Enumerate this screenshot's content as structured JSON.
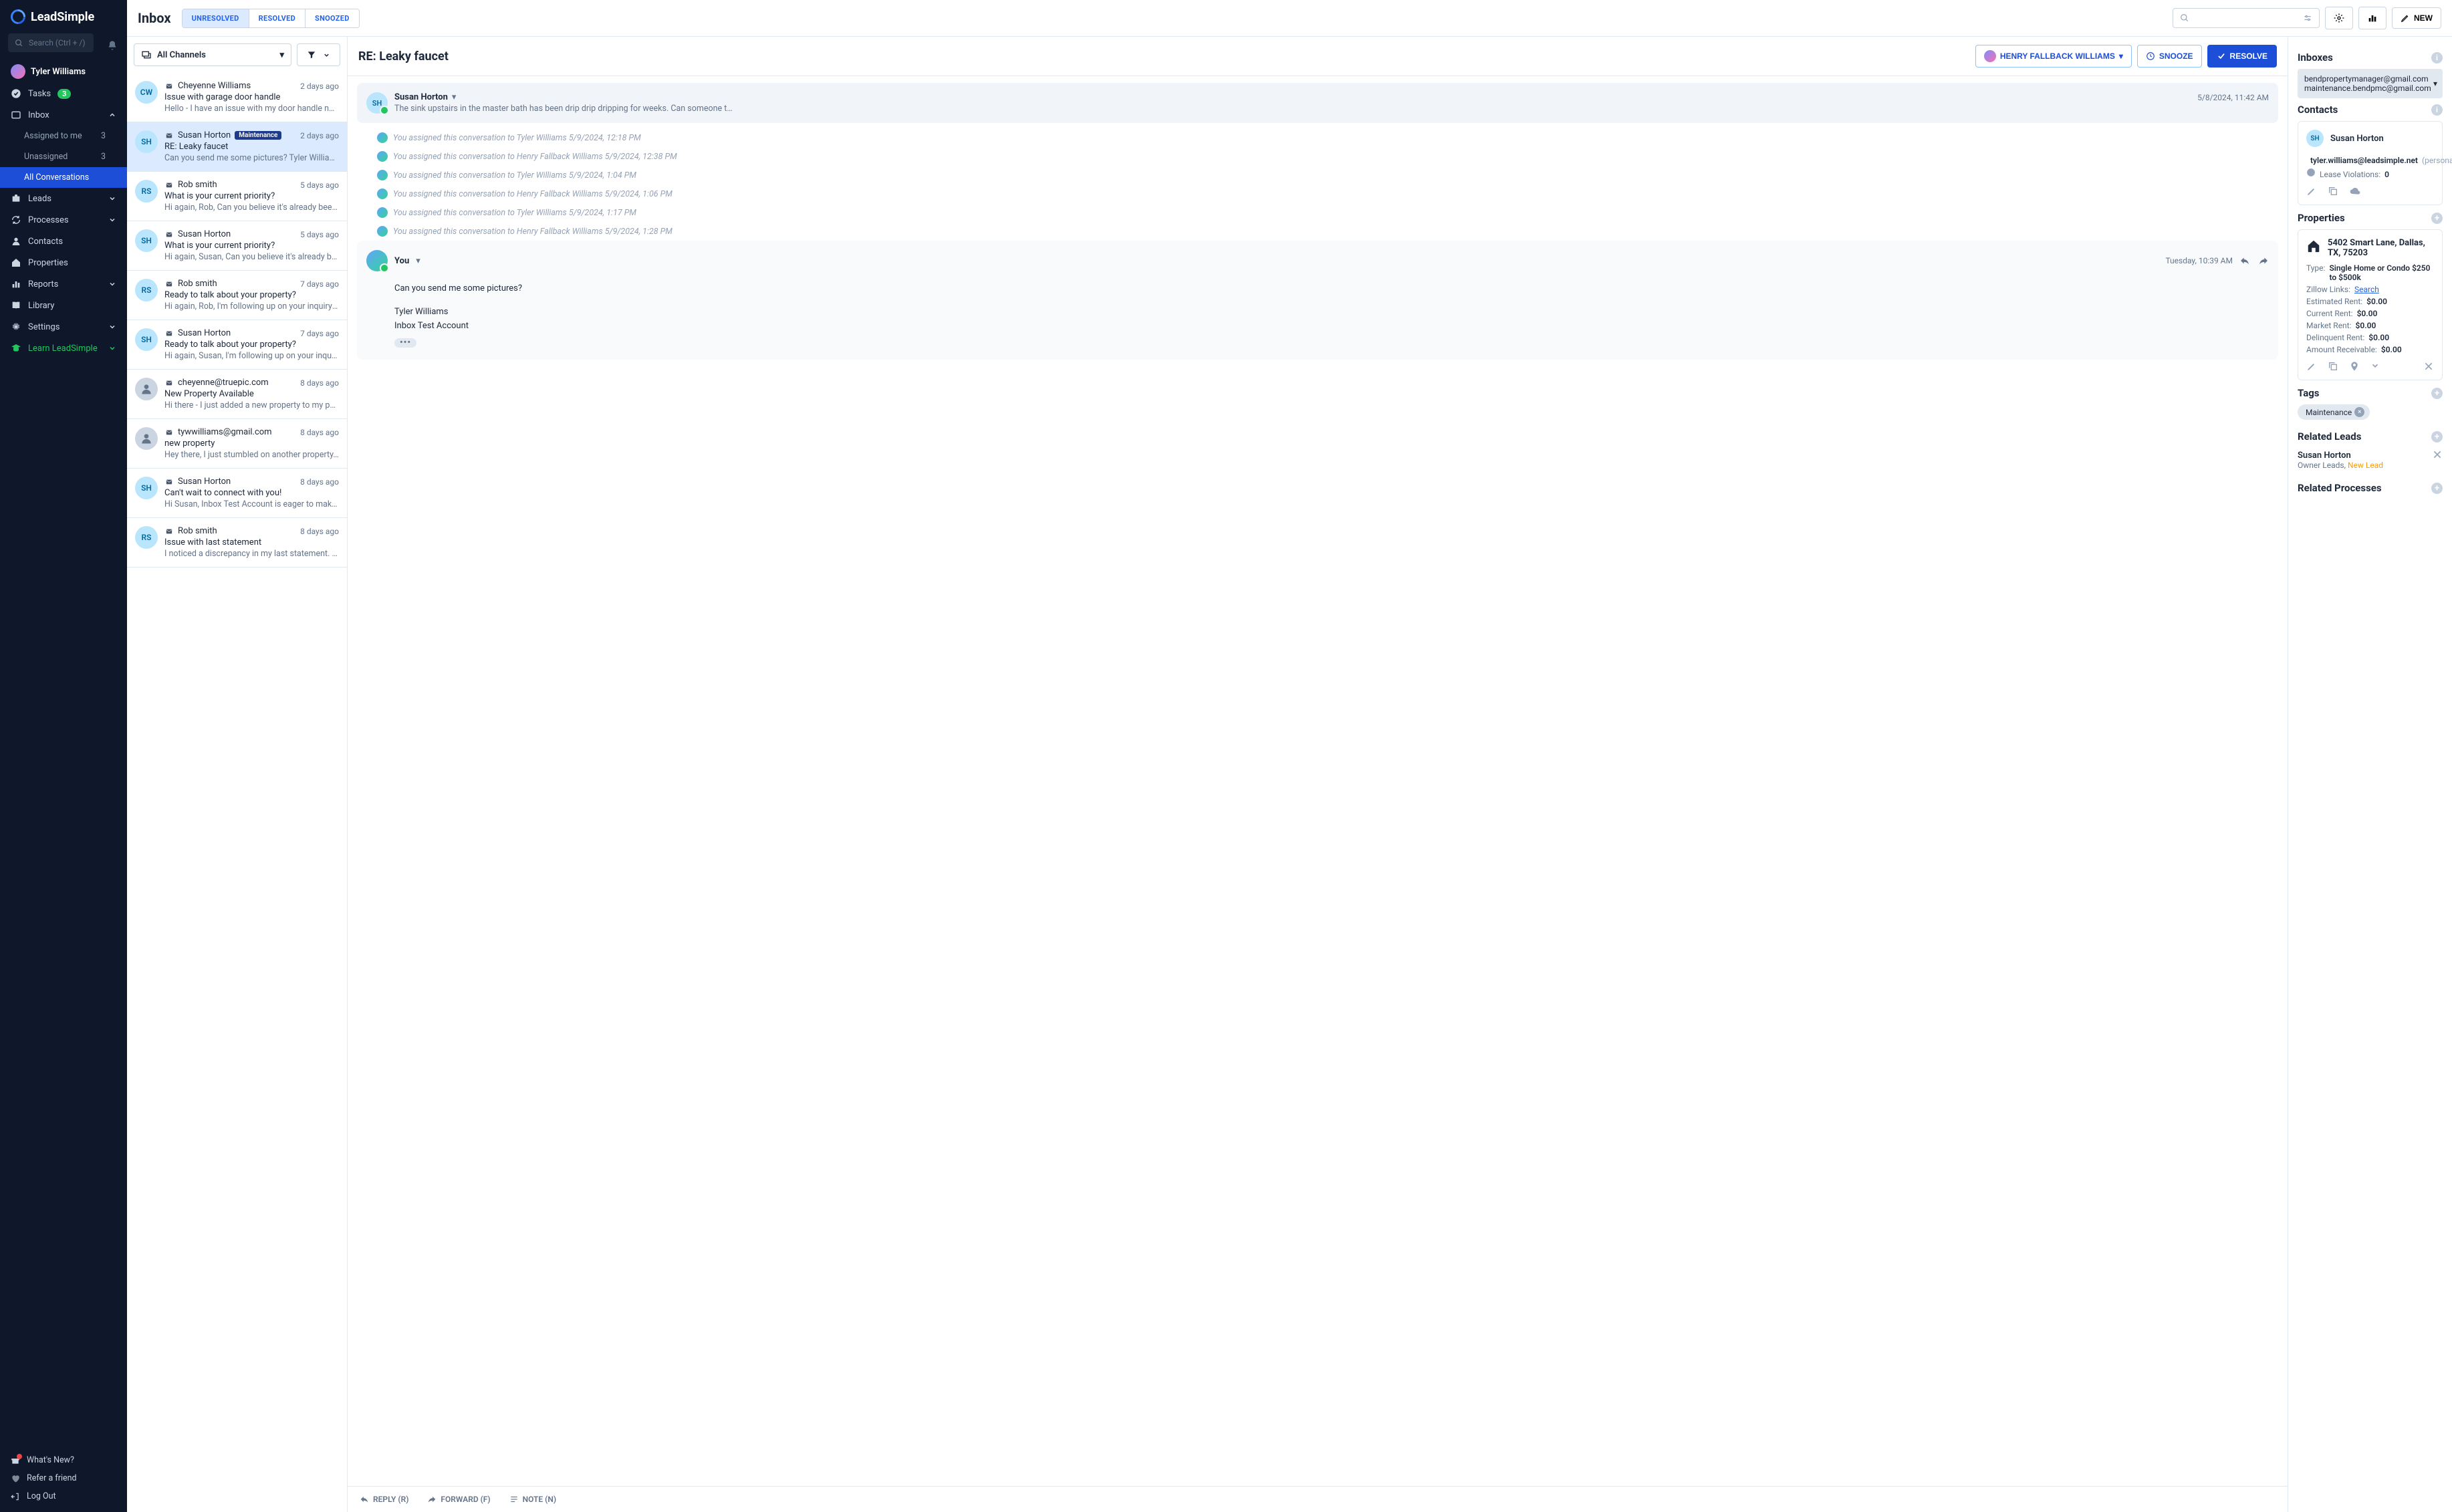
{
  "brand": "LeadSimple",
  "search_placeholder": "Search (Ctrl + /)",
  "user_name": "Tyler Williams",
  "nav": {
    "tasks": "Tasks",
    "tasks_count": "3",
    "inbox": "Inbox",
    "assigned": "Assigned to me",
    "assigned_count": "3",
    "unassigned": "Unassigned",
    "unassigned_count": "3",
    "all": "All Conversations",
    "leads": "Leads",
    "processes": "Processes",
    "contacts": "Contacts",
    "properties": "Properties",
    "reports": "Reports",
    "library": "Library",
    "settings": "Settings",
    "learn": "Learn LeadSimple",
    "whatsnew": "What's New?",
    "refer": "Refer a friend",
    "logout": "Log Out"
  },
  "top": {
    "title": "Inbox",
    "unresolved": "UNRESOLVED",
    "resolved": "RESOLVED",
    "snoozed": "SNOOZED",
    "new": "NEW"
  },
  "filters": {
    "all_channels": "All Channels"
  },
  "conversations": [
    {
      "initials": "CW",
      "name": "Cheyenne Williams",
      "time": "2 days ago",
      "subject": "Issue with garage door handle",
      "preview": "Hello - I have an issue with my door handle not wo…",
      "tag": ""
    },
    {
      "initials": "SH",
      "name": "Susan Horton",
      "time": "2 days ago",
      "subject": "RE: Leaky faucet",
      "preview": "Can you send me some pictures? Tyler Williams In…",
      "tag": "Maintenance",
      "selected": true
    },
    {
      "initials": "RS",
      "name": "Rob smith",
      "time": "5 days ago",
      "subject": "What is your current priority?",
      "preview": "Hi again, Rob, Can you believe it's already been ov…",
      "tag": ""
    },
    {
      "initials": "SH",
      "name": "Susan Horton",
      "time": "5 days ago",
      "subject": "What is your current priority?",
      "preview": "Hi again, Susan, Can you believe it's already been …",
      "tag": ""
    },
    {
      "initials": "RS",
      "name": "Rob smith",
      "time": "7 days ago",
      "subject": "Ready to talk about your property?",
      "preview": "Hi again, Rob, I'm following up on your inquiry abo…",
      "tag": ""
    },
    {
      "initials": "SH",
      "name": "Susan Horton",
      "time": "7 days ago",
      "subject": "Ready to talk about your property?",
      "preview": "Hi again, Susan, I'm following up on your inquiry ab…",
      "tag": ""
    },
    {
      "initials": "",
      "name": "cheyenne@truepic.com",
      "time": "8 days ago",
      "subject": "New Property Available",
      "preview": "Hi there - I just added a new property to my portfo…",
      "tag": "",
      "gray": true
    },
    {
      "initials": "",
      "name": "tywwilliams@gmail.com",
      "time": "8 days ago",
      "subject": "new property",
      "preview": "Hey there, I just stumbled on another property. w…",
      "tag": "",
      "gray": true
    },
    {
      "initials": "SH",
      "name": "Susan Horton",
      "time": "8 days ago",
      "subject": "Can't wait to connect with you!",
      "preview": "Hi Susan, Inbox Test Account is eager to make you…",
      "tag": ""
    },
    {
      "initials": "RS",
      "name": "Rob smith",
      "time": "8 days ago",
      "subject": "Issue with last statement",
      "preview": "I noticed a discrepancy in my last statement. Can …",
      "tag": ""
    }
  ],
  "thread": {
    "subject": "RE: Leaky faucet",
    "assignee": "HENRY FALLBACK WILLIAMS",
    "snooze": "SNOOZE",
    "resolve": "RESOLVE",
    "msg1_from": "Susan Horton",
    "msg1_time": "5/8/2024, 11:42 AM",
    "msg1_preview": "The sink upstairs in the master bath has been drip drip dripping for weeks. Can someone t…",
    "audits": [
      "You assigned this conversation to Tyler Williams 5/9/2024, 12:18 PM",
      "You assigned this conversation to Henry Fallback Williams 5/9/2024, 12:38 PM",
      "You assigned this conversation to Tyler Williams 5/9/2024, 1:04 PM",
      "You assigned this conversation to Henry Fallback Williams 5/9/2024, 1:06 PM",
      "You assigned this conversation to Tyler Williams 5/9/2024, 1:17 PM",
      "You assigned this conversation to Henry Fallback Williams 5/9/2024, 1:28 PM"
    ],
    "msg2_from": "You",
    "msg2_time": "Tuesday, 10:39 AM",
    "msg2_body": "Can you send me some pictures?",
    "msg2_sig1": "Tyler Williams",
    "msg2_sig2": "Inbox Test Account",
    "reply": "REPLY (R)",
    "forward": "FORWARD (F)",
    "note": "NOTE (N)"
  },
  "right": {
    "inboxes_h": "Inboxes",
    "inbox1": "bendpropertymanager@gmail.com",
    "inbox2": "maintenance.bendpmc@gmail.com",
    "contacts_h": "Contacts",
    "contact_name": "Susan Horton",
    "contact_initials": "SH",
    "contact_email": "tyler.williams@leadsimple.net",
    "contact_email_suffix": "(persona",
    "lease_label": "Lease Violations:",
    "lease_val": "0",
    "props_h": "Properties",
    "prop_addr": "5402 Smart Lane, Dallas, TX, 75203",
    "type_l": "Type:",
    "type_v": "Single Home or Condo $250 to $500k",
    "zillow_l": "Zillow Links:",
    "zillow_v": "Search",
    "est_l": "Estimated Rent:",
    "est_v": "$0.00",
    "cur_l": "Current Rent:",
    "cur_v": "$0.00",
    "mkt_l": "Market Rent:",
    "mkt_v": "$0.00",
    "del_l": "Delinquent Rent:",
    "del_v": "$0.00",
    "rec_l": "Amount Receivable:",
    "rec_v": "$0.00",
    "tags_h": "Tags",
    "tag1": "Maintenance",
    "leads_h": "Related Leads",
    "lead_name": "Susan Horton",
    "lead_sub1": "Owner Leads,",
    "lead_sub2": "New Lead",
    "proc_h": "Related Processes"
  }
}
